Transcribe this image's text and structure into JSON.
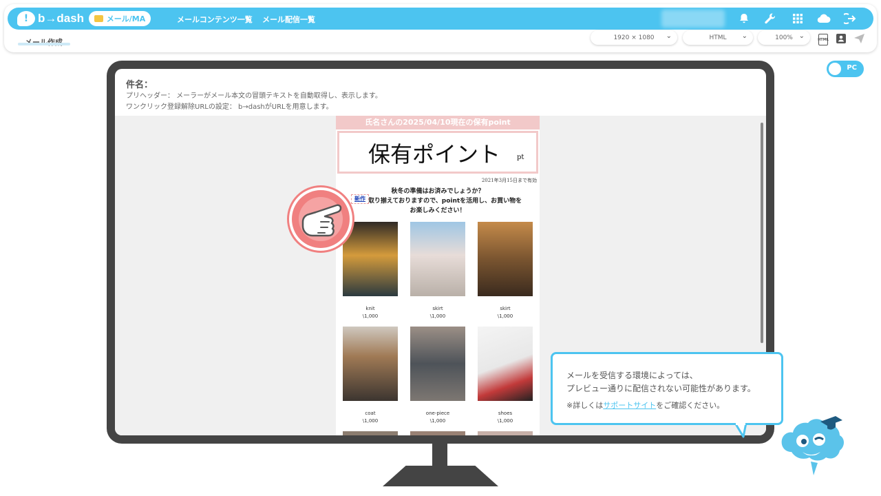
{
  "header": {
    "logo_text": "b→dash",
    "nav_active": "メール/MA",
    "nav_links": [
      "メールコンテンツ一覧",
      "メール配信一覧"
    ],
    "icons": [
      "bell-icon",
      "wrench-icon",
      "grid-icon",
      "cloud-icon",
      "logout-icon"
    ]
  },
  "subbar": {
    "title": "メール作成",
    "resolution": "1920 × 1080",
    "format": "HTML",
    "zoom": "100%"
  },
  "toggle": {
    "label": "PC"
  },
  "editor": {
    "subject_label": "件名：",
    "preheader": "プリヘッダー： メーラーがメール本文の冒頭テキストを自動取得し、表示します。",
    "unsubscribe": "ワンクリック登録解除URLの設定： b→dashがURLを用意します。"
  },
  "email": {
    "header": "氏名さんの2025/04/10現在の保有point",
    "big_title": "保有ポイント",
    "unit": "pt",
    "valid": "2021年3月15日まで有効",
    "msg1": "秋冬の準備はお済みでしょうか？",
    "msg2": "を取り揃えておりますので、pointを活用し、お買い物を",
    "msg3": "お楽しみください！",
    "new_tag": "新作",
    "products": [
      {
        "name": "knit",
        "price": "\\1,000",
        "color": "#c89a3a"
      },
      {
        "name": "skirt",
        "price": "\\1,000",
        "color": "#e6d7d3"
      },
      {
        "name": "skirt",
        "price": "\\1,000",
        "color": "#9c6a3c"
      },
      {
        "name": "coat",
        "price": "\\1,000",
        "color": "#a07a55"
      },
      {
        "name": "one-piece",
        "price": "\\1,000",
        "color": "#6d7278"
      },
      {
        "name": "shoes",
        "price": "\\1,000",
        "color": "#ececec"
      }
    ]
  },
  "bubble": {
    "line1": "メールを受信する環境によっては、",
    "line2": "プレビュー通りに配信されない可能性があります。",
    "note_prefix": "※詳しくは",
    "note_link": "サポートサイト",
    "note_suffix": "をご確認ください。"
  }
}
